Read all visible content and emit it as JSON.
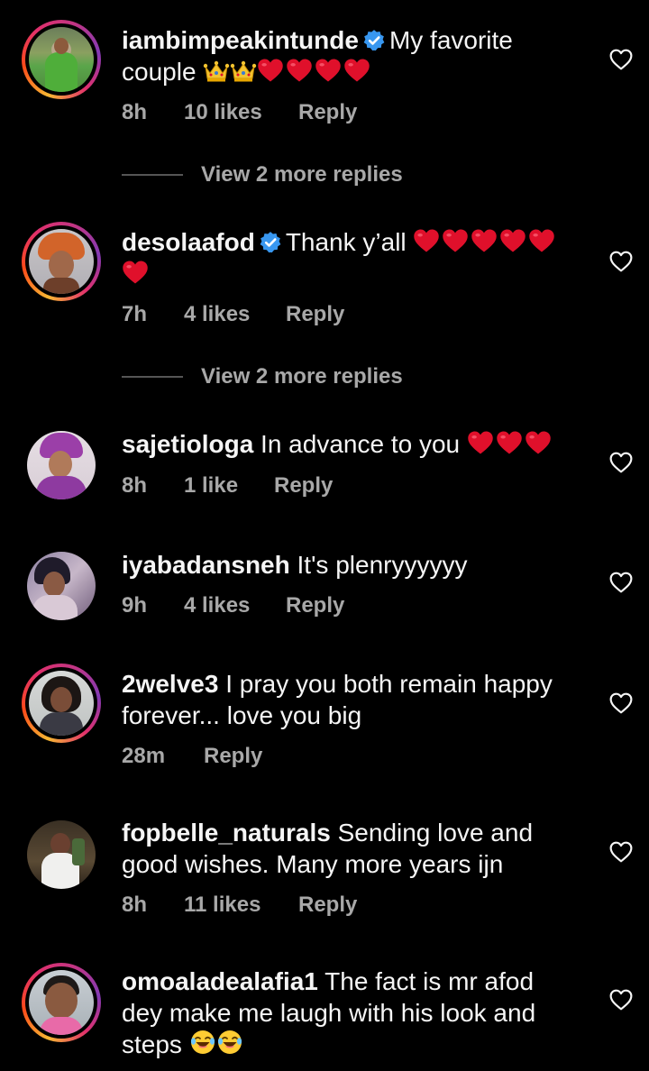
{
  "comments": [
    {
      "username": "iambimpeakintunde",
      "verified": true,
      "text": "My favorite couple",
      "emojis": "👑👑❤️❤️❤️❤️",
      "time": "8h",
      "likes": "10 likes",
      "reply": "Reply",
      "view_replies": "View 2 more replies"
    },
    {
      "username": "desolaafod",
      "verified": true,
      "text": "Thank y’all",
      "emojis": "❤️❤️❤️❤️❤️❤️",
      "time": "7h",
      "likes": "4 likes",
      "reply": "Reply",
      "view_replies": "View 2 more replies"
    },
    {
      "username": "sajetiologa",
      "verified": false,
      "text": "In advance to you",
      "emojis": "❤️❤️❤️",
      "time": "8h",
      "likes": "1 like",
      "reply": "Reply"
    },
    {
      "username": "iyabadansneh",
      "verified": false,
      "text": "It's plenryyyyyy",
      "time": "9h",
      "likes": "4 likes",
      "reply": "Reply"
    },
    {
      "username": "2welve3",
      "verified": false,
      "text": "I pray you both remain happy forever... love you big",
      "time": "28m",
      "reply": "Reply"
    },
    {
      "username": "fopbelle_naturals",
      "verified": false,
      "text": "Sending love and good wishes. Many more years ijn",
      "time": "8h",
      "likes": "11 likes",
      "reply": "Reply"
    },
    {
      "username": "omoaladealafia1",
      "verified": false,
      "text": "The fact is mr afod dey make me laugh with his look and steps",
      "emojis": "😂😂"
    }
  ],
  "colors": {
    "background": "#000000",
    "text": "#f5f5f5",
    "muted": "#a8a8a8",
    "verified_blue": "#3897f0",
    "emoji_heart": "#e0102b"
  },
  "icons": {
    "like": "heart-outline-icon",
    "verified": "verified-badge-icon"
  }
}
